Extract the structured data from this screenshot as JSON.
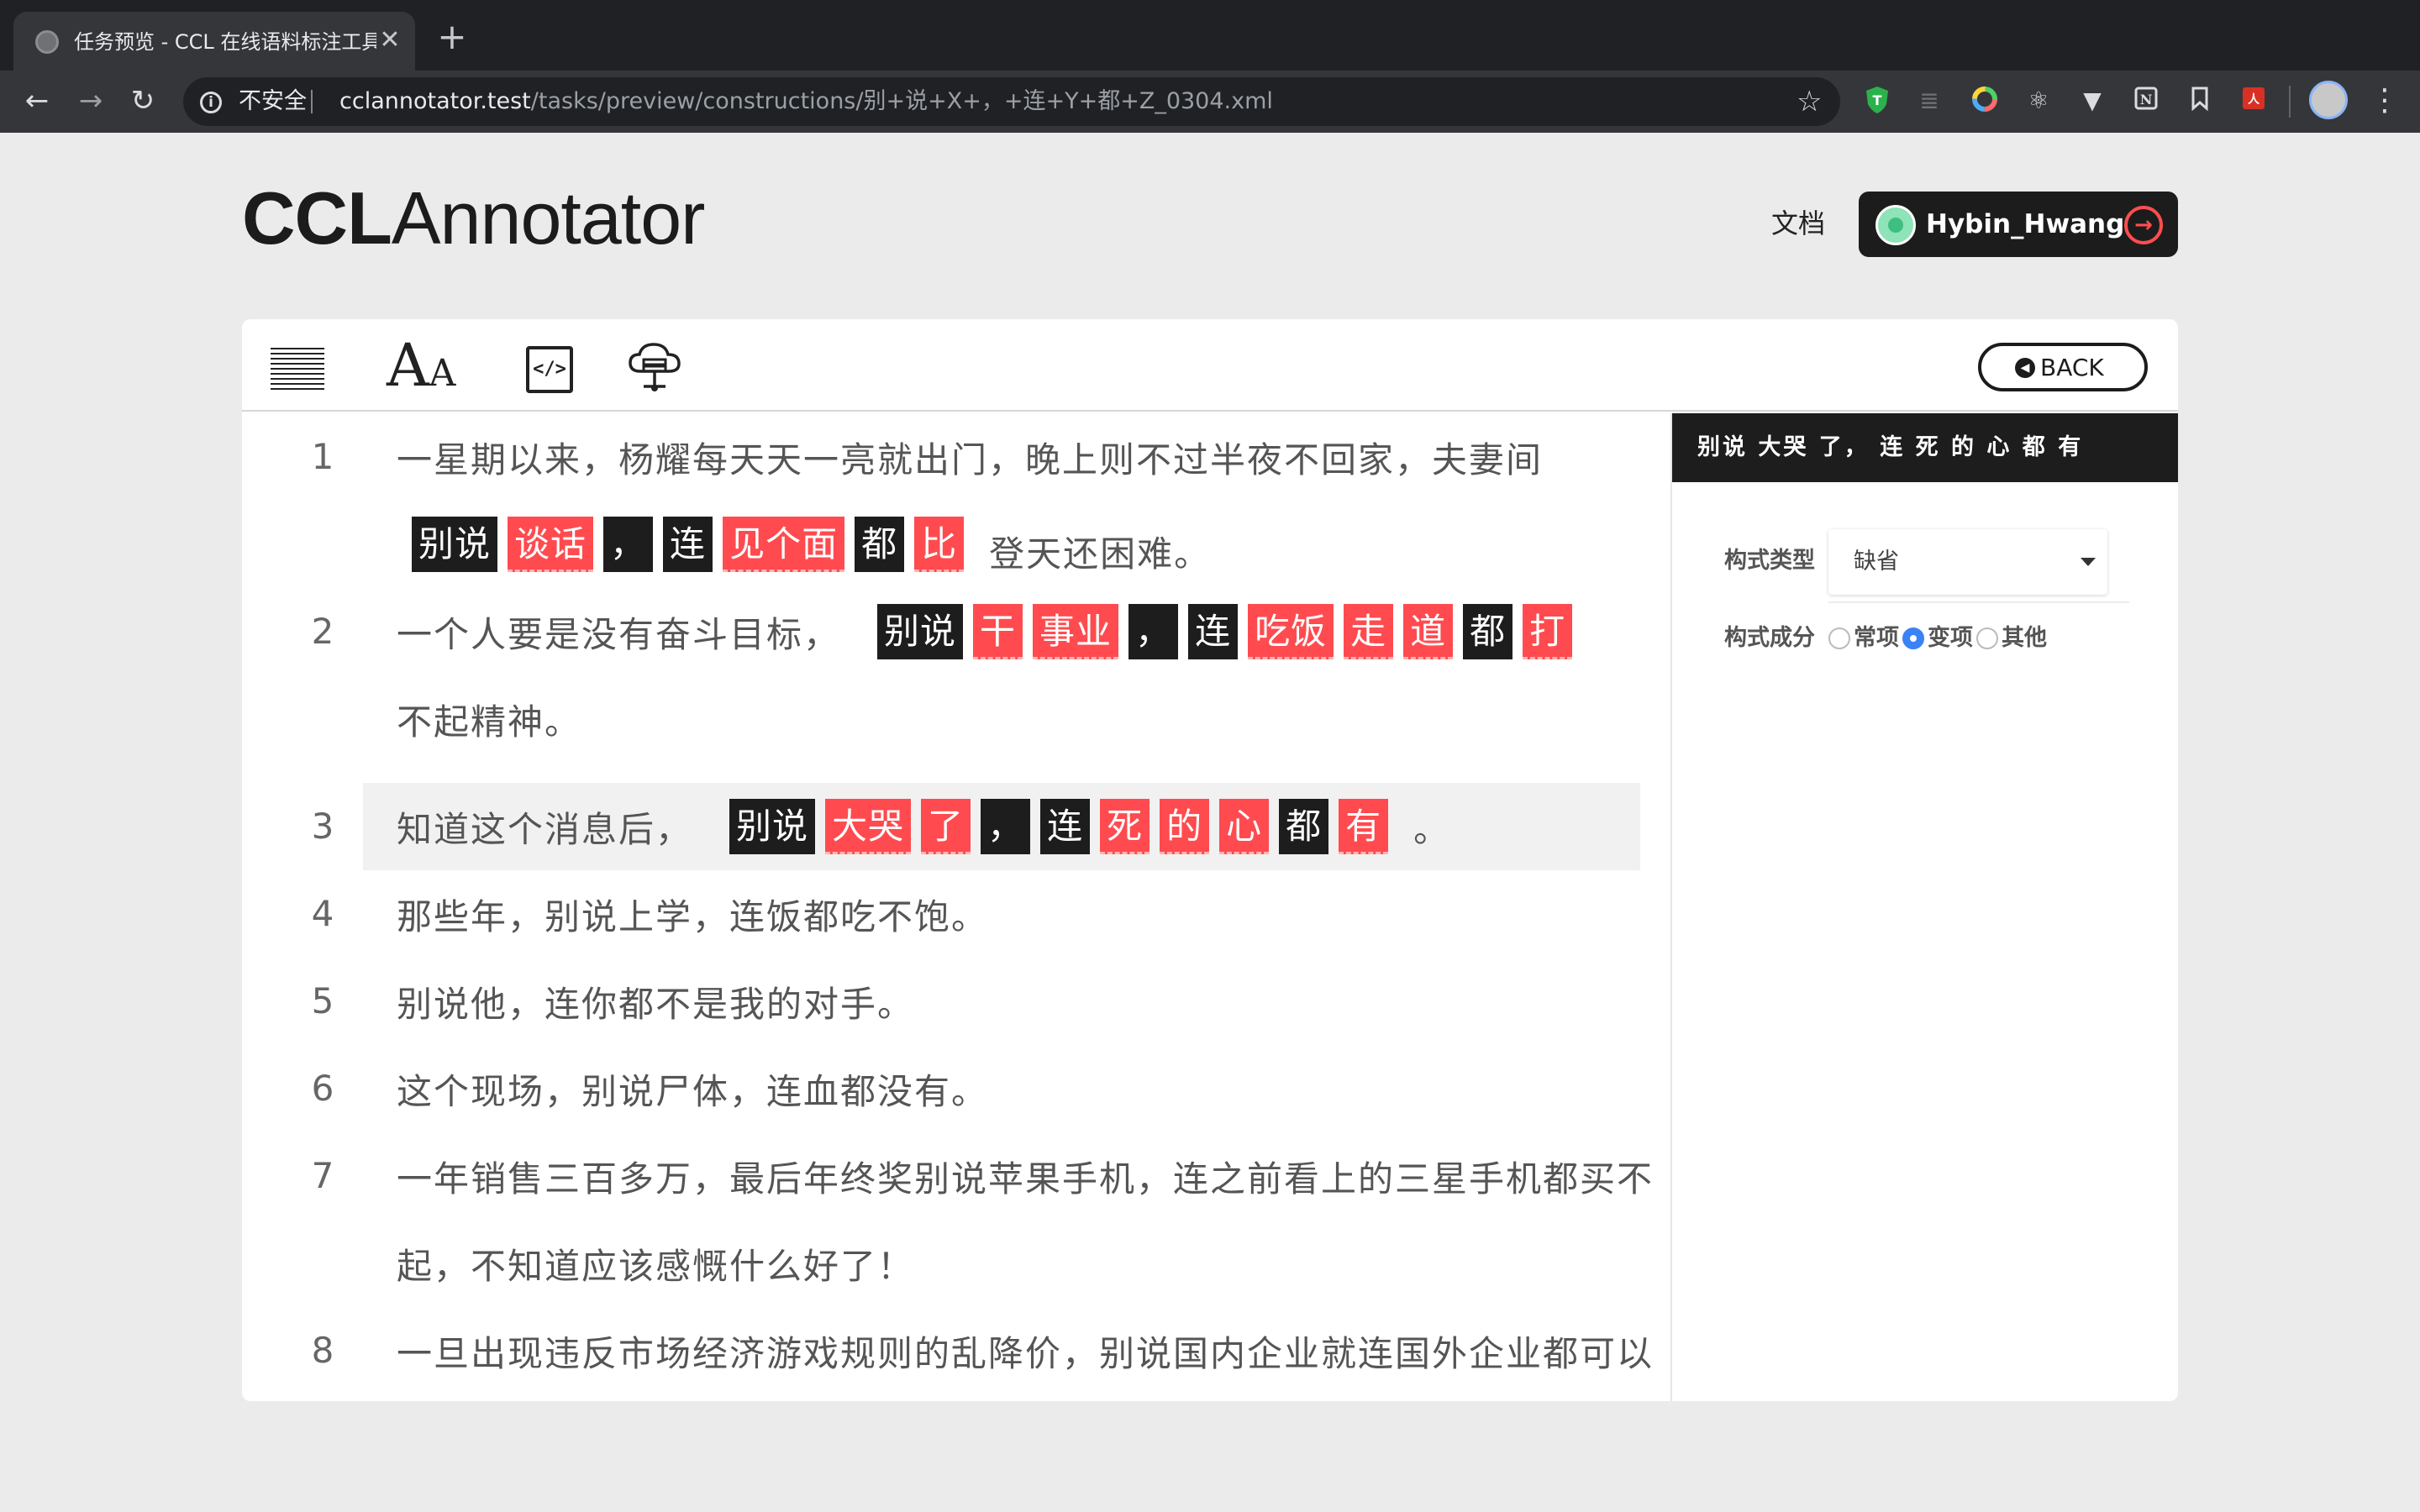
{
  "browser": {
    "tab_title": "任务预览 - CCL 在线语料标注工具",
    "tab_close": "✕",
    "new_tab": "+",
    "insecure_label": "不安全",
    "url_host": "cclannotator.test",
    "url_path": "/tasks/preview/constructions/别+说+X+，+连+Y+都+Z_0304.xml"
  },
  "header": {
    "logo_bold": "CCL",
    "logo_light": "Annotator",
    "docs_link": "文档",
    "user_name": "Hybin_Hwang"
  },
  "toolbar": {
    "font_tool_big": "A",
    "font_tool_small": "A",
    "code_tool": "</>",
    "back_label": "BACK"
  },
  "sentences": [
    {
      "num": "1",
      "line1": "一星期以来，杨耀每天天一亮就出门，晚上则不过半夜不回家，夫妻间",
      "tokens": [
        {
          "t": "别说",
          "k": "k"
        },
        {
          "t": "谈话",
          "k": "v"
        },
        {
          "t": "，",
          "k": "k"
        },
        {
          "t": "连",
          "k": "k"
        },
        {
          "t": "见个面",
          "k": "v"
        },
        {
          "t": "都",
          "k": "k"
        },
        {
          "t": "比",
          "k": "v"
        }
      ],
      "tail": "登天还困难。"
    },
    {
      "num": "2",
      "head": "一个人要是没有奋斗目标，",
      "tokens": [
        {
          "t": "别说",
          "k": "k"
        },
        {
          "t": "干",
          "k": "v"
        },
        {
          "t": "事业",
          "k": "v"
        },
        {
          "t": "，",
          "k": "k"
        },
        {
          "t": "连",
          "k": "k"
        },
        {
          "t": "吃饭",
          "k": "v"
        },
        {
          "t": "走",
          "k": "v"
        },
        {
          "t": "道",
          "k": "v"
        },
        {
          "t": "都",
          "k": "k"
        },
        {
          "t": "打",
          "k": "v"
        }
      ],
      "line2": "不起精神。"
    },
    {
      "num": "3",
      "head": "知道这个消息后，",
      "tokens": [
        {
          "t": "别说",
          "k": "k"
        },
        {
          "t": "大哭",
          "k": "v"
        },
        {
          "t": "了",
          "k": "v"
        },
        {
          "t": "，",
          "k": "k"
        },
        {
          "t": "连",
          "k": "k"
        },
        {
          "t": "死",
          "k": "v"
        },
        {
          "t": "的",
          "k": "v"
        },
        {
          "t": "心",
          "k": "v"
        },
        {
          "t": "都",
          "k": "k"
        },
        {
          "t": "有",
          "k": "v"
        }
      ],
      "tail": "。"
    },
    {
      "num": "4",
      "text": "那些年，别说上学，连饭都吃不饱。"
    },
    {
      "num": "5",
      "text": "别说他，连你都不是我的对手。"
    },
    {
      "num": "6",
      "text": "这个现场，别说尸体，连血都没有。"
    },
    {
      "num": "7",
      "text": "一年销售三百多万，最后年终奖别说苹果手机，连之前看上的三星手机都买不",
      "text2": "起，不知道应该感慨什么好了！"
    },
    {
      "num": "8",
      "text": "一旦出现违反市场经济游戏规则的乱降价，别说国内企业就连国外企业都可以"
    }
  ],
  "panel": {
    "title": "别说 大哭 了， 连 死 的 心 都 有",
    "type_label": "构式类型",
    "type_value": "缺省",
    "component_label": "构式成分",
    "options": [
      "常项",
      "变项",
      "其他"
    ],
    "selected_option": "变项"
  }
}
